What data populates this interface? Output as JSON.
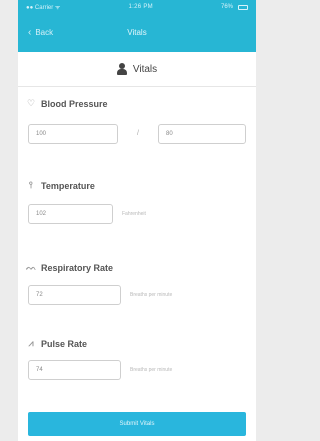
{
  "status_bar": {
    "carrier": "●● Carrier ᯤ",
    "time": "1:26 PM",
    "battery": "76%"
  },
  "nav": {
    "back_label": "Back",
    "title": "Vitals"
  },
  "header": {
    "title": "Vitals"
  },
  "blood_pressure": {
    "label": "Blood Pressure",
    "systolic": "100",
    "diastolic": "80",
    "separator": "/"
  },
  "temperature": {
    "label": "Temperature",
    "value": "102",
    "unit": "Fahrenheit"
  },
  "respiratory_rate": {
    "label": "Respiratory Rate",
    "value": "72",
    "unit": "Breaths per minute"
  },
  "pulse_rate": {
    "label": "Pulse Rate",
    "value": "74",
    "unit": "Breaths per minute"
  },
  "submit": {
    "label": "Submit Vitals"
  },
  "colors": {
    "accent": "#27b6d4",
    "button": "#29b6dd"
  }
}
